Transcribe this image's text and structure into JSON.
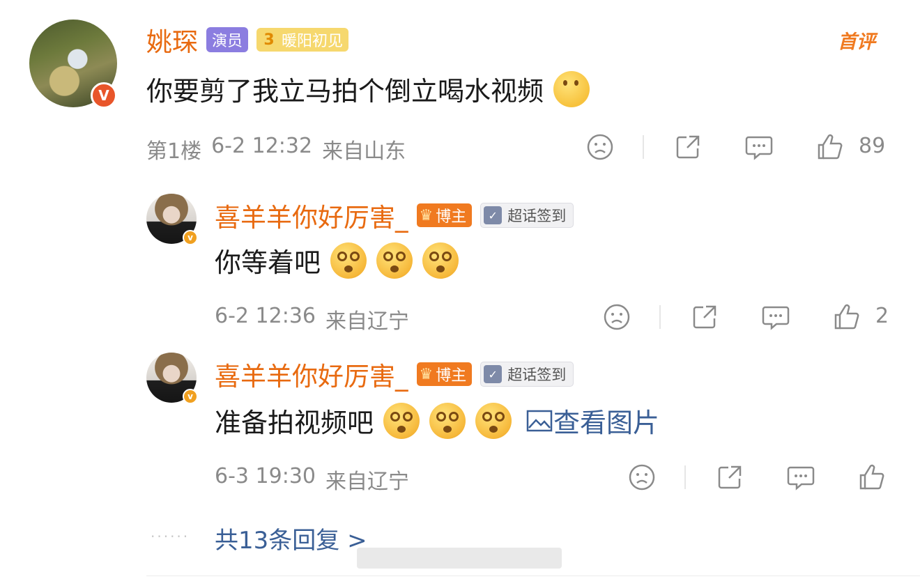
{
  "comment": {
    "username": "姚琛",
    "tag_actor": "演员",
    "level_num": "3",
    "level_text": "暖阳初见",
    "first_label": "首评",
    "text": "你要剪了我立马拍个倒立喝水视频",
    "floor": "第1楼",
    "time": "6-2 12:32",
    "location": "来自山东",
    "likes": "89"
  },
  "replies": [
    {
      "username": "喜羊羊你好厉害_",
      "tag_blogger": "博主",
      "tag_checkin": "超话签到",
      "text": "你等着吧",
      "time": "6-2 12:36",
      "location": "来自辽宁",
      "likes": "2"
    },
    {
      "username": "喜羊羊你好厉害_",
      "tag_blogger": "博主",
      "tag_checkin": "超话签到",
      "text": "准备拍视频吧",
      "view_image": "查看图片",
      "time": "6-3 19:30",
      "location": "来自辽宁",
      "likes": ""
    }
  ],
  "more_replies": "共13条回复 >",
  "icons": {
    "verified": "v-badge-icon",
    "dislike": "sad-face-icon",
    "share": "share-icon",
    "comment": "comment-icon",
    "like": "thumbs-up-icon",
    "image": "image-icon"
  },
  "colors": {
    "username": "#e86a10",
    "link": "#3a5f96",
    "meta": "#8a8a8a"
  }
}
